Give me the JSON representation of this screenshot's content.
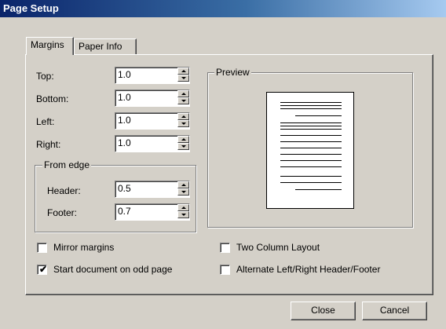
{
  "window": {
    "title": "Page Setup"
  },
  "tabs": [
    {
      "label": "Margins",
      "active": true
    },
    {
      "label": "Paper Info",
      "active": false
    }
  ],
  "margins": {
    "top": {
      "label": "Top:",
      "value": "1.0"
    },
    "bottom": {
      "label": "Bottom:",
      "value": "1.0"
    },
    "left": {
      "label": "Left:",
      "value": "1.0"
    },
    "right": {
      "label": "Right:",
      "value": "1.0"
    }
  },
  "from_edge": {
    "title": "From edge",
    "header": {
      "label": "Header:",
      "value": "0.5"
    },
    "footer": {
      "label": "Footer:",
      "value": "0.7"
    }
  },
  "preview": {
    "title": "Preview"
  },
  "options": {
    "mirror_margins": {
      "label": "Mirror margins",
      "checked": false
    },
    "start_odd_page": {
      "label": "Start document on odd page",
      "checked": true
    },
    "two_column": {
      "label": "Two Column Layout",
      "checked": false
    },
    "alternate_header": {
      "label": "Alternate Left/Right Header/Footer",
      "checked": false
    }
  },
  "buttons": {
    "close": "Close",
    "cancel": "Cancel"
  },
  "colors": {
    "titlebar_start": "#0a246a",
    "titlebar_end": "#a6caf0",
    "face": "#d4d0c8"
  }
}
